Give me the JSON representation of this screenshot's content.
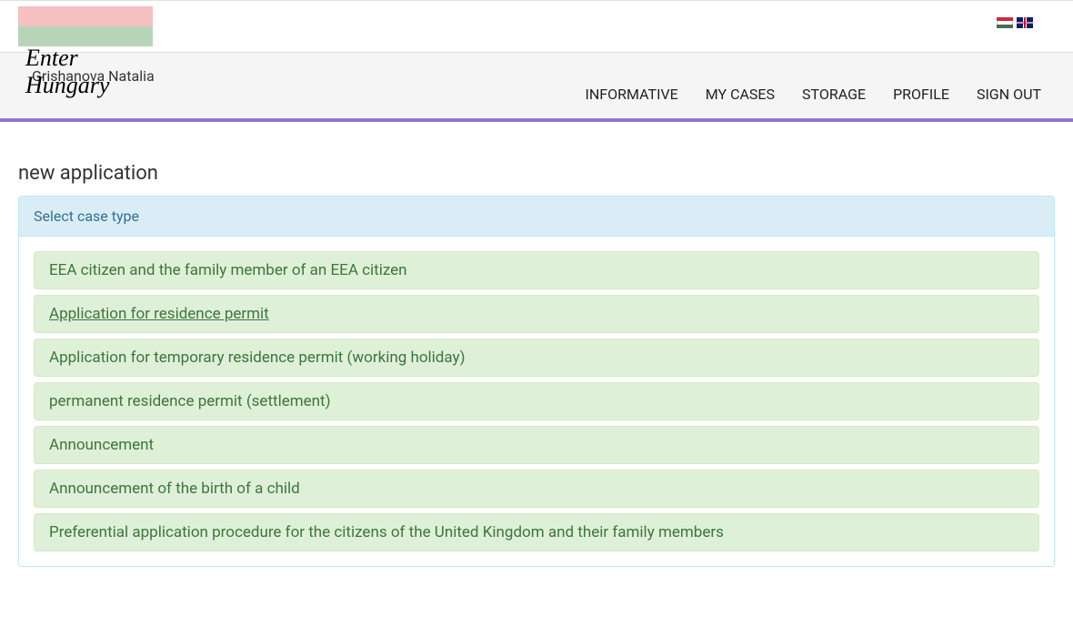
{
  "header": {
    "logo_text": "Enter Hungary"
  },
  "nav": {
    "user_name": "Grishanova Natalia",
    "links": {
      "informative": "INFORMATIVE",
      "my_cases": "MY CASES",
      "storage": "STORAGE",
      "profile": "PROFILE",
      "sign_out": "SIGN OUT"
    }
  },
  "page": {
    "title": "new application",
    "panel_header": "Select case type"
  },
  "case_types": [
    "EEA citizen and the family member of an EEA citizen",
    "Application for residence permit",
    "Application for temporary residence permit (working holiday)",
    "permanent residence permit (settlement)",
    "Announcement",
    "Announcement of the birth of a child",
    "Preferential application procedure for the citizens of the United Kingdom and their family members"
  ],
  "hovered_index": 1
}
